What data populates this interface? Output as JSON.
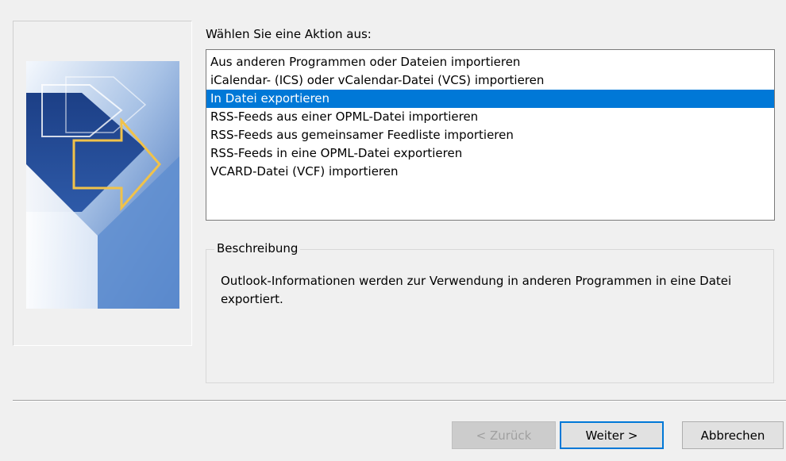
{
  "action_prompt": "Wählen Sie eine Aktion aus:",
  "actions": [
    {
      "label": "Aus anderen Programmen oder Dateien importieren",
      "selected": false
    },
    {
      "label": "iCalendar- (ICS) oder vCalendar-Datei (VCS) importieren",
      "selected": false
    },
    {
      "label": "In Datei exportieren",
      "selected": true
    },
    {
      "label": "RSS-Feeds aus einer OPML-Datei importieren",
      "selected": false
    },
    {
      "label": "RSS-Feeds aus gemeinsamer Feedliste importieren",
      "selected": false
    },
    {
      "label": "RSS-Feeds in eine OPML-Datei exportieren",
      "selected": false
    },
    {
      "label": "VCARD-Datei (VCF) importieren",
      "selected": false
    }
  ],
  "description": {
    "title": "Beschreibung",
    "text": "Outlook-Informationen werden zur Verwendung in anderen Programmen in eine Datei exportiert."
  },
  "buttons": {
    "back": "< Zurück",
    "next": "Weiter >",
    "cancel": "Abbrechen"
  },
  "colors": {
    "selection": "#0078d7",
    "dialog_background": "#f0f0f0"
  }
}
